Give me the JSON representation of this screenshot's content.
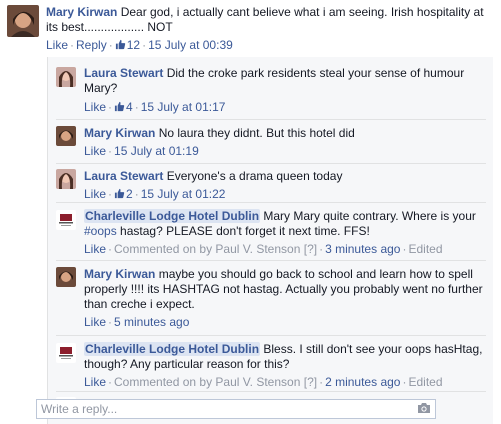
{
  "comment": {
    "author": "Mary Kirwan",
    "text": "Dear god, i actually cant believe what i am seeing. Irish hospitality at its best.................. NOT",
    "like": "Like",
    "reply": "Reply",
    "likes": "12",
    "timestamp": "15 July at 00:39"
  },
  "replies": [
    {
      "author": "Laura Stewart",
      "text": "Did the croke park residents steal your sense of humour Mary?",
      "like": "Like",
      "likes": "4",
      "timestamp": "15 July at 01:17"
    },
    {
      "author": "Mary Kirwan",
      "text": "No laura they didnt. But this hotel did",
      "like": "Like",
      "timestamp": "15 July at 01:19"
    },
    {
      "author": "Laura Stewart",
      "text": "Everyone's a drama queen today",
      "like": "Like",
      "likes": "2",
      "timestamp": "15 July at 01:22"
    },
    {
      "author": "Charleville Lodge Hotel Dublin",
      "text_a": "Mary Mary quite contrary. Where is your",
      "hashtag": "#oops",
      "text_b": "hastag? PLEASE don't forget it next time. FFS!",
      "like": "Like",
      "commented_on_by": "Commented on by",
      "poster": "Paul V. Stenson",
      "info": "[?]",
      "timestamp": "3 minutes ago",
      "edited": "Edited"
    },
    {
      "author": "Mary Kirwan",
      "text": "maybe you should go back to school and learn how to spell properly !!!! its HASHTAG not hastag. Actually you probably went no further than creche i expect.",
      "like": "Like",
      "timestamp": "5 minutes ago"
    },
    {
      "author": "Charleville Lodge Hotel Dublin",
      "text": "Bless. I still don't see your oops hasHtag, though? Any particular reason for this?",
      "like": "Like",
      "commented_on_by": "Commented on by",
      "poster": "Paul V. Stenson",
      "info": "[?]",
      "timestamp": "2 minutes ago",
      "edited": "Edited"
    }
  ],
  "reply_box": {
    "placeholder": "Write a reply..."
  },
  "icons": {
    "like": "thumbs-up-icon",
    "camera": "camera-icon"
  },
  "colors": {
    "link": "#3b5998",
    "meta": "#9197a3",
    "highlight": "#dce4f2"
  }
}
